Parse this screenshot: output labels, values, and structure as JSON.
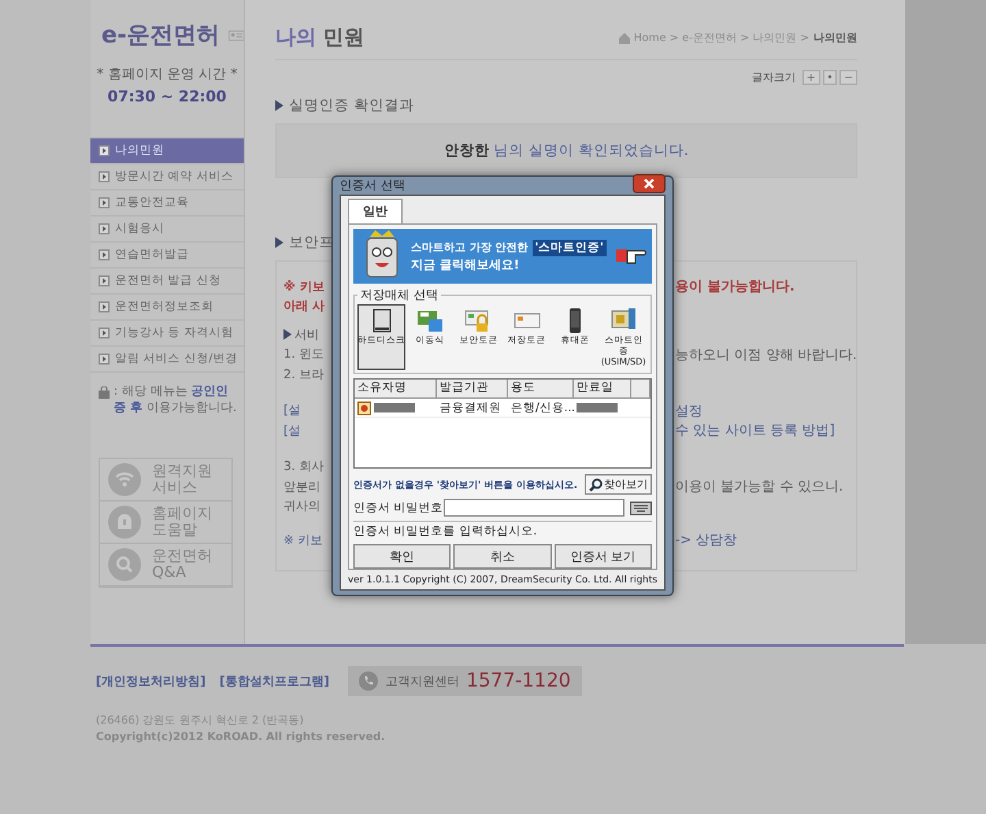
{
  "sidebar": {
    "logo": "e-운전면허",
    "hours_label": "* 홈페이지 운영 시간 *",
    "hours": "07:30 ~ 22:00",
    "menu": [
      {
        "label": "나의민원",
        "selected": true
      },
      {
        "label": "방문시간 예약 서비스",
        "selected": false
      },
      {
        "label": "교통안전교육",
        "selected": false
      },
      {
        "label": "시험응시",
        "selected": false
      },
      {
        "label": "연습면허발급",
        "selected": false
      },
      {
        "label": "운전면허 발급 신청",
        "selected": false
      },
      {
        "label": "운전면허정보조회",
        "selected": false
      },
      {
        "label": "기능강사 등 자격시험",
        "selected": false
      },
      {
        "label": "알림 서비스 신청/변경",
        "selected": false
      }
    ],
    "note": ": 해당 메뉴는 **공인인증 후** 이용가능합니다.",
    "help_links": [
      {
        "kind": "remote",
        "label": "원격지원 서비스"
      },
      {
        "kind": "help",
        "label": "홈페이지 도움말"
      },
      {
        "kind": "qna",
        "label": "운전면허 Q&A"
      }
    ]
  },
  "page": {
    "title_accent": "나의",
    "title": "민원",
    "breadcrumb": "Home > e-운전면허 > 나의민원 > ",
    "breadcrumb_current": "나의민원",
    "font_size": {
      "label": "글자크기",
      "buttons": [
        "+",
        "•",
        "−"
      ]
    },
    "result_section": {
      "heading": "실명인증 확인결과",
      "name": "안창한",
      "message": "님의 실명이 확인되었습니다."
    },
    "security_section": {
      "heading": "보안프",
      "rows": [
        {
          "kind": "warning",
          "left": "※ 키보",
          "right": "용이 불가능합니다."
        },
        {
          "kind": "warning",
          "left": "아래 사",
          "right": ""
        },
        {
          "kind": "heading",
          "left": "서비",
          "right": ""
        },
        {
          "kind": "text",
          "left": "1. 윈도",
          "right": "능하오니 이점 양해 바랍니다."
        },
        {
          "kind": "text",
          "left": "2. 브라",
          "right": ""
        },
        {
          "kind": "link",
          "left": "[설",
          "right": "설정"
        },
        {
          "kind": "link",
          "left": "[설",
          "right": "수 있는 사이트 등록 방법]"
        },
        {
          "kind": "text",
          "left": "3. 회사",
          "right": ""
        },
        {
          "kind": "text",
          "left": "앞분리",
          "right": "이용이 불가능할 수 있으니."
        },
        {
          "kind": "text",
          "left": "귀사의",
          "right": ""
        },
        {
          "kind": "link",
          "left": "※ 키보",
          "right": "-> 상담창"
        }
      ]
    }
  },
  "dialog": {
    "title": "인증서 선택",
    "tabs": [
      {
        "label": "일반",
        "selected": true
      }
    ],
    "banner": {
      "headline": "스마트하고 가장 안전한",
      "highlight": "'스마트인증'",
      "subline": "지금 클릭해보세요!"
    },
    "storage": {
      "legend": "저장매체 선택",
      "items": [
        {
          "kind": "disk",
          "label": "하드디스크",
          "selected": true
        },
        {
          "kind": "removable",
          "label": "이동식",
          "selected": false
        },
        {
          "kind": "token",
          "label": "보안토큰",
          "selected": false
        },
        {
          "kind": "storage-token",
          "label": "저장토큰",
          "selected": false
        },
        {
          "kind": "phone",
          "label": "휴대폰",
          "selected": false
        },
        {
          "kind": "usim",
          "label": "스마트인증 (USIM/SD)",
          "selected": false
        }
      ]
    },
    "table": {
      "columns": [
        "소유자명",
        "발급기관",
        "용도",
        "만료일"
      ],
      "rows": [
        {
          "cells": [
            "",
            "금융결제원",
            "은행/신용...",
            ""
          ]
        }
      ]
    },
    "hint": "인증서가 없을경우 '찾아보기' 버튼을 이용하십시오.",
    "browse_button": "찾아보기",
    "password_label": "인증서 비밀번호",
    "status": "인증서 비밀번호를 입력하십시오.",
    "buttons": [
      "확인",
      "취소",
      "인증서 보기"
    ],
    "version": "ver 1.0.1.1",
    "copyright": "Copyright (C) 2007, DreamSecurity Co. Ltd. All rights"
  },
  "footer": {
    "links": [
      "[개인정보처리방침]",
      "[통합설치프로그램]"
    ],
    "support_label": "고객지원센터",
    "support_phone": "1577-1120",
    "address": "(26466) 강원도 원주시 혁신로 2 (반곡동)",
    "copyright": "Copyright(c)2012 KoROAD. All rights reserved."
  }
}
